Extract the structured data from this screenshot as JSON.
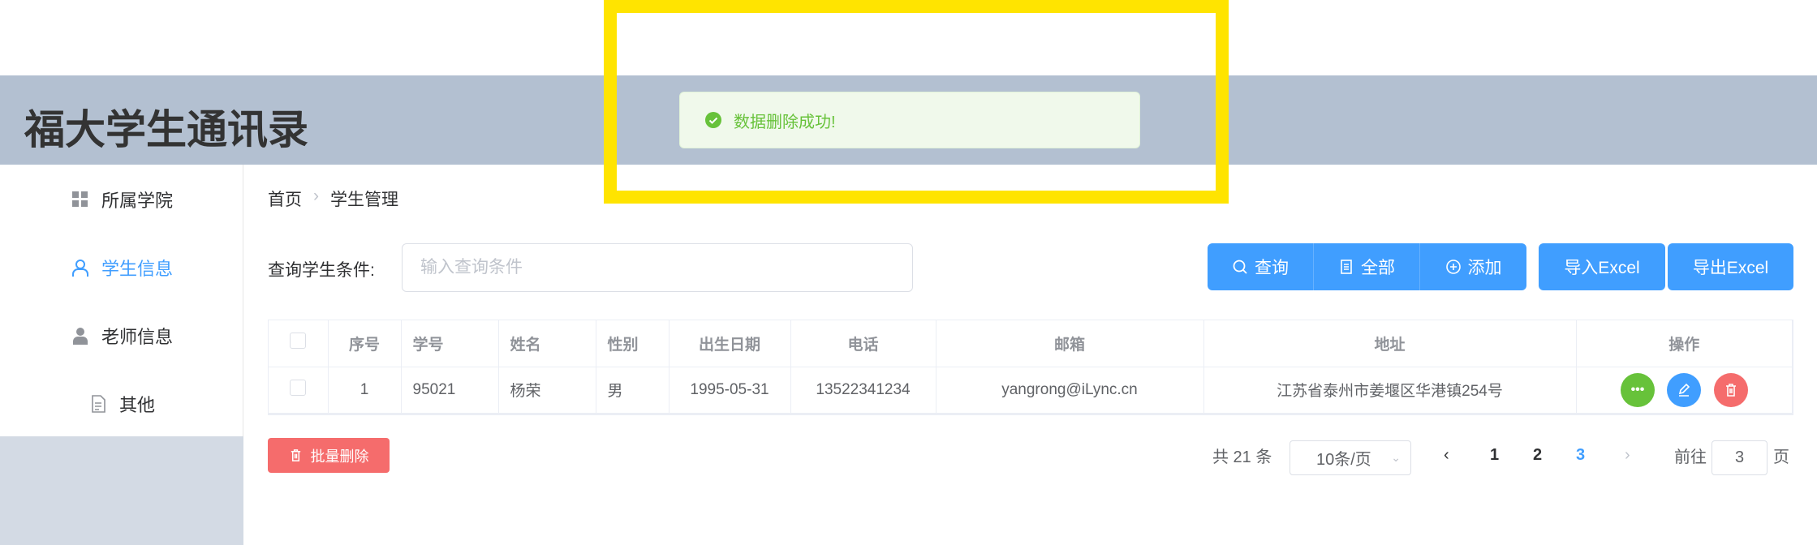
{
  "app": {
    "title": "福大学生通讯录"
  },
  "toast": {
    "message": "数据删除成功!",
    "icon": "check-circle-icon",
    "color": "#67c23a"
  },
  "sidebar": {
    "items": [
      {
        "label": "所属学院",
        "icon": "grid-icon"
      },
      {
        "label": "学生信息",
        "icon": "user-outline-icon",
        "active": true
      },
      {
        "label": "老师信息",
        "icon": "user-filled-icon"
      },
      {
        "label": "其他",
        "icon": "document-icon"
      }
    ]
  },
  "breadcrumb": {
    "home": "首页",
    "current": "学生管理"
  },
  "search": {
    "label": "查询学生条件:",
    "placeholder": "输入查询条件",
    "value": ""
  },
  "toolbar": {
    "query": "查询",
    "all": "全部",
    "add": "添加",
    "import": "导入Excel",
    "export": "导出Excel"
  },
  "table": {
    "headers": [
      "序号",
      "学号",
      "姓名",
      "性别",
      "出生日期",
      "电话",
      "邮箱",
      "地址",
      "操作"
    ],
    "rows": [
      [
        "1",
        "95021",
        "杨荣",
        "男",
        "1995-05-31",
        "13522341234",
        "yangrong@iLync.cn",
        "江苏省泰州市姜堰区华港镇254号"
      ]
    ]
  },
  "batch_delete": "批量删除",
  "pagination": {
    "total": "共 21 条",
    "page_size": "10条/页",
    "pages": [
      "1",
      "2",
      "3"
    ],
    "current_page": 3,
    "goto_label": "前往",
    "goto_value": "3",
    "page_suffix": "页"
  },
  "colors": {
    "primary": "#409eff",
    "danger": "#f56c6c",
    "success": "#67c23a",
    "header_bg": "#b3c0d1"
  }
}
